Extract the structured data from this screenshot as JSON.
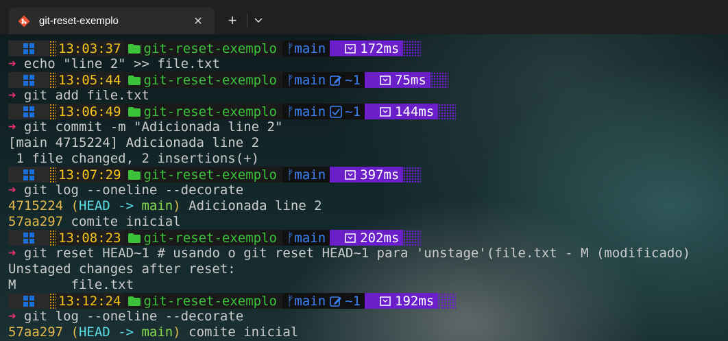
{
  "tab": {
    "title": "git-reset-exemplo",
    "close_label": "✕"
  },
  "tabbar": {
    "new_tab_label": "+",
    "dropdown_icon": "chevron-down-icon"
  },
  "prompt_text": {
    "dir": "git-reset-exemplo",
    "branch": "main"
  },
  "prompts": [
    {
      "time": "13:03:37",
      "status": "",
      "duration": "172ms"
    },
    {
      "time": "13:05:44",
      "status": "~1",
      "duration": "75ms"
    },
    {
      "time": "13:06:49",
      "status": "~1",
      "duration": "144ms"
    },
    {
      "time": "13:07:29",
      "status": "",
      "duration": "397ms"
    },
    {
      "time": "13:08:23",
      "status": "",
      "duration": "202ms"
    },
    {
      "time": "13:12:24",
      "status": "~1",
      "duration": "192ms"
    }
  ],
  "commands": [
    "echo \"line 2\" >> file.txt",
    "git add file.txt",
    "git commit -m \"Adicionada line 2\"",
    "git log --oneline --decorate",
    "git reset HEAD~1 # usando o git reset HEAD~1 para 'unstage'(file.txt - M (modificado)",
    "git log --oneline --decorate"
  ],
  "arrow": "➜",
  "output": {
    "commit_result_1": "[main 4715224] Adicionada line 2",
    "commit_result_2": " 1 file changed, 2 insertions(+)",
    "log1_hash": "4715224",
    "log1_open": " (",
    "log1_head": "HEAD -> ",
    "log1_branch": "main",
    "log1_close": ")",
    "log1_msg": " Adicionada line 2",
    "log2_hash": "57aa297",
    "log2_msg": " comite inicial",
    "reset_1": "Unstaged changes after reset:",
    "reset_2": "M       file.txt",
    "log3_hash": "57aa297",
    "log3_open": " (",
    "log3_head": "HEAD -> ",
    "log3_branch": "main",
    "log3_close": ")",
    "log3_msg": " comite inicial"
  },
  "colors": {
    "prompt_arrow": "#e8326e",
    "time": "#f5c518",
    "dir": "#3bc23b",
    "git": "#3b82f6",
    "duration_bg": "#6b1fc9",
    "hash": "#e5b94a",
    "head": "#5be0e8",
    "branch": "#86d94d"
  }
}
